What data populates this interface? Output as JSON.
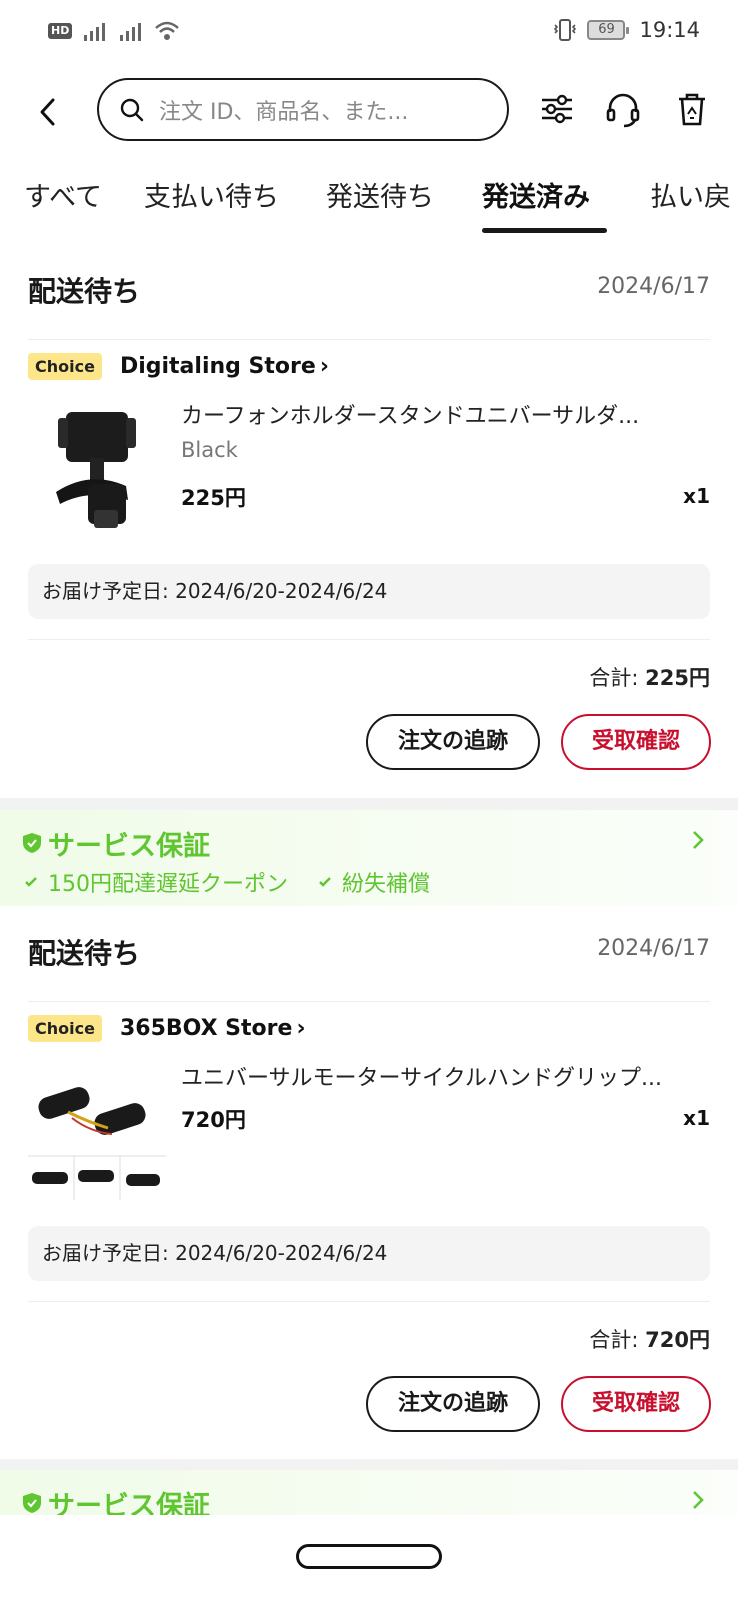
{
  "status_bar": {
    "hd_label": "HD",
    "battery": "69",
    "time": "19:14"
  },
  "search": {
    "placeholder": "注文 ID、商品名、また..."
  },
  "tabs": [
    {
      "label": "すべて"
    },
    {
      "label": "支払い待ち"
    },
    {
      "label": "発送待ち"
    },
    {
      "label": "発送済み",
      "active": true
    },
    {
      "label": "払い戻"
    }
  ],
  "orders": [
    {
      "status": "配送待ち",
      "date": "2024/6/17",
      "badge": "Choice",
      "store": "Digitaling Store",
      "product_title": "カーフォンホルダースタンドユニバーサルダ...",
      "variant": "Black",
      "price": "225円",
      "qty": "x1",
      "delivery": "お届け予定日: 2024/6/20-2024/6/24",
      "total_label": "合計:",
      "total_value": "225円",
      "track_label": "注文の追跡",
      "confirm_label": "受取確認"
    },
    {
      "status": "配送待ち",
      "date": "2024/6/17",
      "badge": "Choice",
      "store": "365BOX Store",
      "product_title": "ユニバーサルモーターサイクルハンドグリップ...",
      "price": "720円",
      "qty": "x1",
      "delivery": "お届け予定日: 2024/6/20-2024/6/24",
      "total_label": "合計:",
      "total_value": "720円",
      "track_label": "注文の追跡",
      "confirm_label": "受取確認"
    }
  ],
  "service": {
    "title": "サービス保証",
    "items": [
      "150円配達遅延クーポン",
      "紛失補償"
    ]
  },
  "colors": {
    "accent_red": "#c8102e",
    "service_green": "#5fc531",
    "choice_yellow": "#fde68a"
  }
}
